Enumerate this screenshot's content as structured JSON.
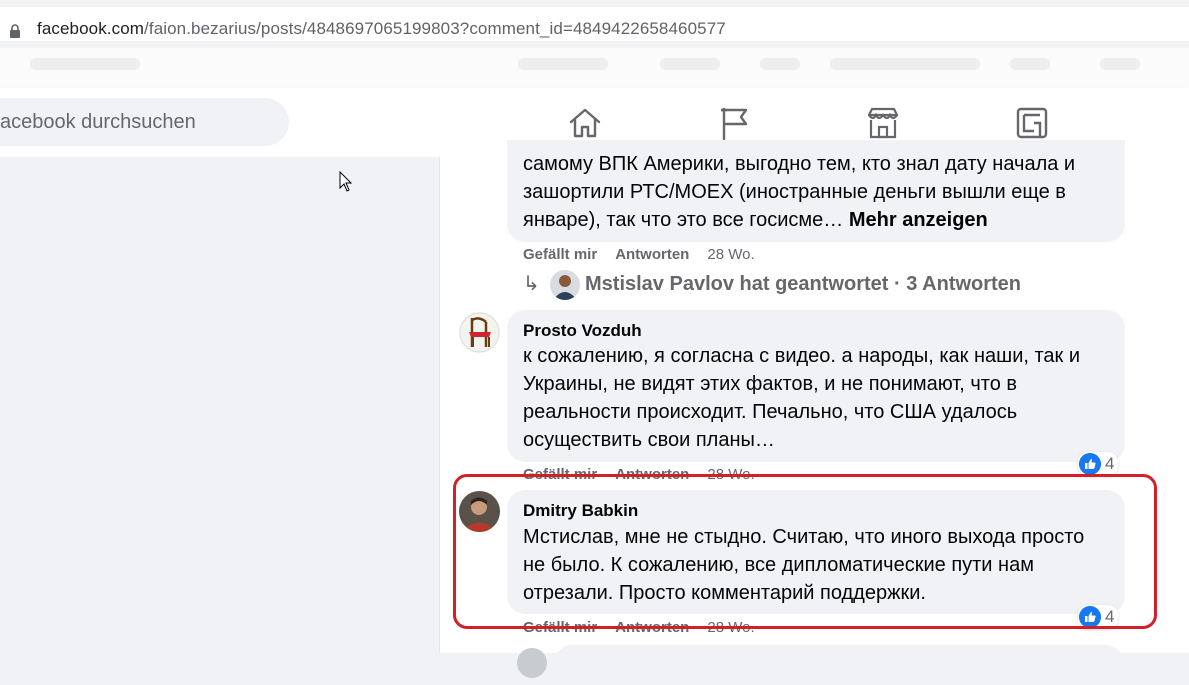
{
  "browser": {
    "url_domain": "facebook.com",
    "url_path": "/faion.bezarius/posts/4848697065199803?comment_id=4849422658460577"
  },
  "header": {
    "search_placeholder": "acebook durchsuchen",
    "nav_icons": [
      "home-icon",
      "pages-flag-icon",
      "marketplace-icon",
      "gaming-icon"
    ]
  },
  "comments": [
    {
      "lines": [
        "самому ВПК Америки, выгодно тем, кто знал дату начала и",
        "зашортили РТС/MOEX (иностранные деньги вышли еще в",
        "январе), так что это все госисме… "
      ],
      "more_label": "Mehr anzeigen",
      "like_label": "Gefällt mir",
      "reply_label": "Antworten",
      "age": "28 Wo."
    },
    {
      "author": "Prosto Vozduh",
      "lines": [
        "к сожалению, я согласна с видео. а народы, как наши, так и",
        "Украины, не видят этих фактов, и не понимают, что в",
        "реальности происходит. Печально, что США удалось",
        "осуществить свои планы…"
      ],
      "reactions": "4",
      "like_label": "Gefällt mir",
      "reply_label": "Antworten",
      "age": "28 Wo."
    },
    {
      "author": "Dmitry Babkin",
      "lines": [
        "Мстислав, мне не стыдно. Считаю, что иного выхода просто",
        "не было. К сожалению, все дипломатические пути нам",
        "отрезали. Просто комментарий поддержки."
      ],
      "reactions": "4",
      "like_label": "Gefällt mir",
      "reply_label": "Antworten",
      "age": "28 Wo."
    }
  ],
  "replies_link": {
    "arrow": "↳",
    "text": "Mstislav Pavlov hat geantwortet · 3 Antworten"
  },
  "colors": {
    "highlight_border": "#d51f28",
    "like_blue": "#1877f2",
    "bubble": "#f0f2f5",
    "secondary_text": "#65676b"
  }
}
